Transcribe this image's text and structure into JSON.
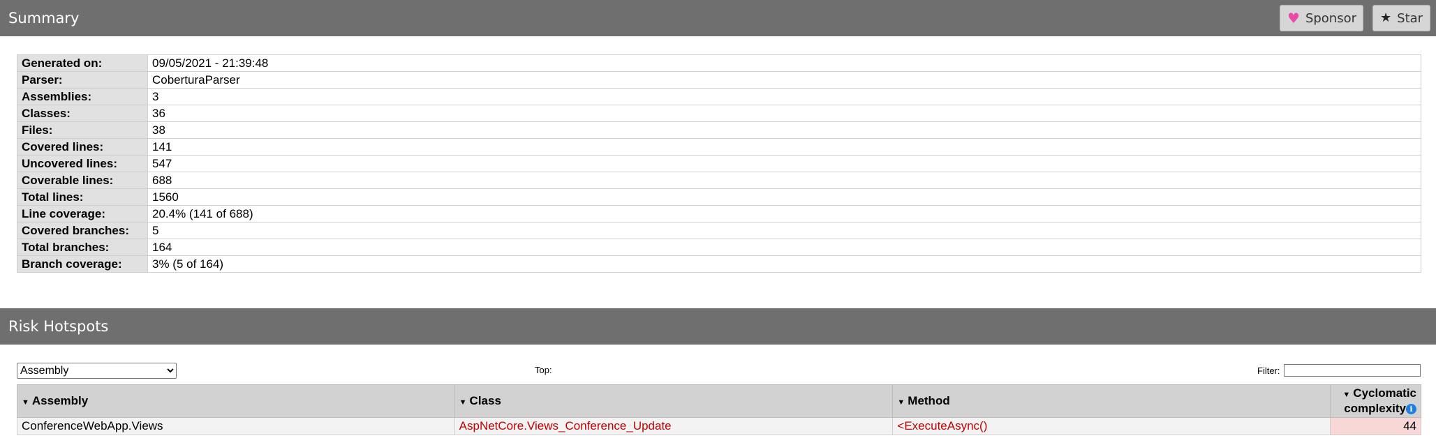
{
  "summary": {
    "title": "Summary",
    "sponsor_label": "Sponsor",
    "star_label": "Star",
    "rows": [
      {
        "label": "Generated on:",
        "value": "09/05/2021 - 21:39:48"
      },
      {
        "label": "Parser:",
        "value": "CoberturaParser"
      },
      {
        "label": "Assemblies:",
        "value": "3"
      },
      {
        "label": "Classes:",
        "value": "36"
      },
      {
        "label": "Files:",
        "value": "38"
      },
      {
        "label": "Covered lines:",
        "value": "141"
      },
      {
        "label": "Uncovered lines:",
        "value": "547"
      },
      {
        "label": "Coverable lines:",
        "value": "688"
      },
      {
        "label": "Total lines:",
        "value": "1560"
      },
      {
        "label": "Line coverage:",
        "value": "20.4% (141 of 688)"
      },
      {
        "label": "Covered branches:",
        "value": "5"
      },
      {
        "label": "Total branches:",
        "value": "164"
      },
      {
        "label": "Branch coverage:",
        "value": "3% (5 of 164)"
      }
    ]
  },
  "risk": {
    "title": "Risk Hotspots",
    "group_select_value": "Assembly",
    "top_label": "Top:",
    "filter_label": "Filter:",
    "filter_value": "",
    "headers": {
      "assembly": "Assembly",
      "class": "Class",
      "method": "Method",
      "cc_line1": "Cyclomatic",
      "cc_line2": "complexity"
    },
    "rows": [
      {
        "assembly": "ConferenceWebApp.Views",
        "class": "AspNetCore.Views_Conference_Update",
        "method": "<ExecuteAsync()",
        "complexity": "44"
      }
    ]
  },
  "icons": {
    "sponsor": "heart-icon",
    "star": "star-icon",
    "sort": "sort-down-icon",
    "info": "info-icon"
  },
  "colors": {
    "header_bg": "#6f6f6f",
    "link": "#c00000",
    "risk_cell": "#f8d7d7",
    "heart": "#ea4aaa"
  }
}
